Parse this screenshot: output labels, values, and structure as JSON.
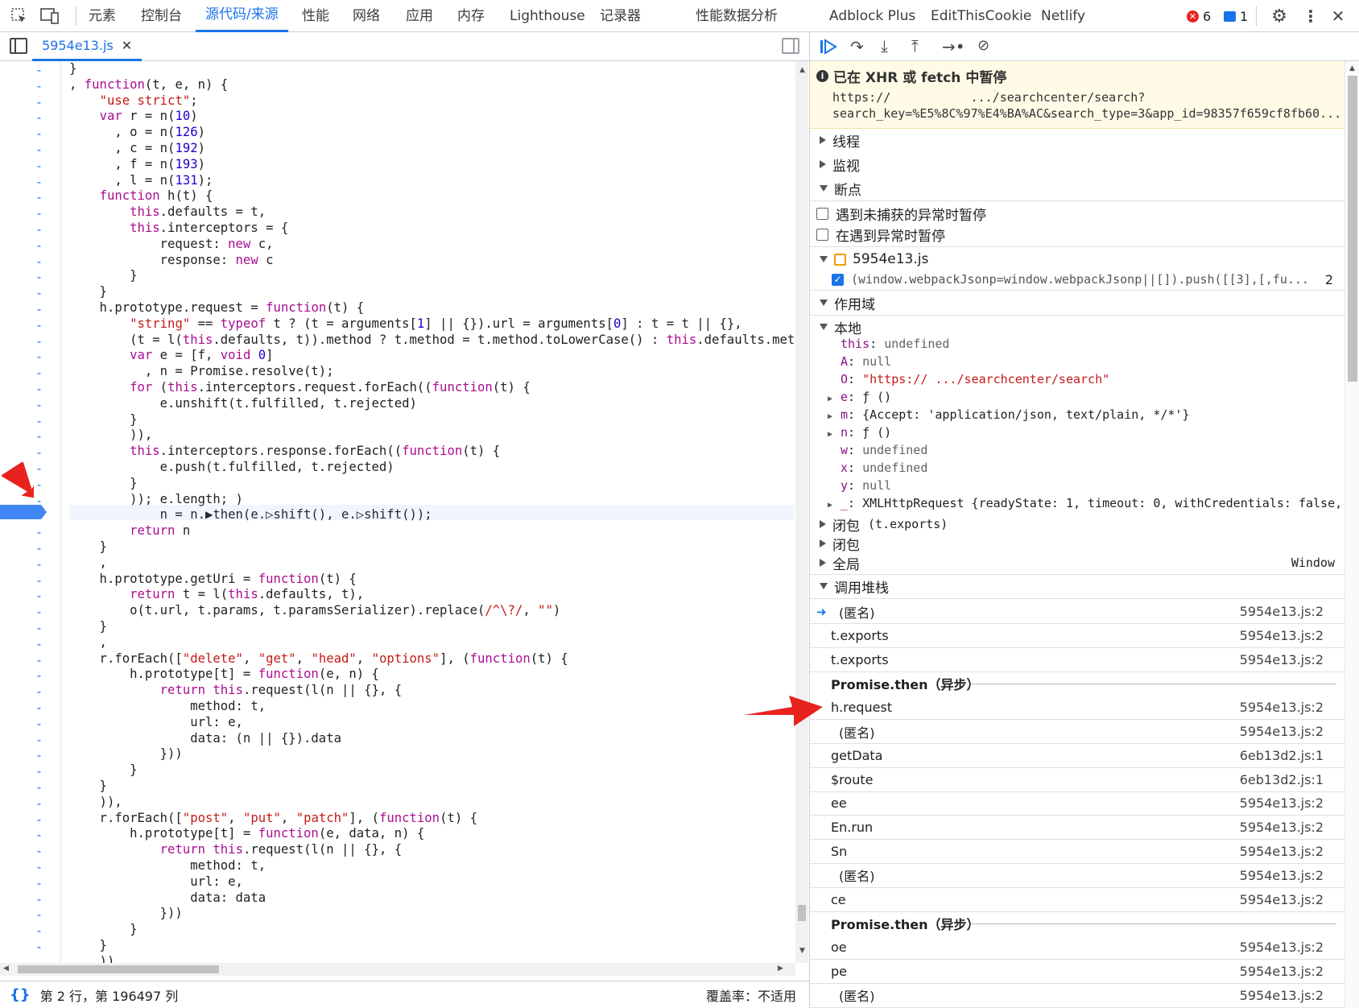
{
  "tabs": [
    "元素",
    "控制台",
    "源代码/来源",
    "性能",
    "网络",
    "应用",
    "内存",
    "Lighthouse",
    "记录器",
    "性能数据分析",
    "Adblock Plus",
    "EditThisCookie",
    "Netlify"
  ],
  "errors_count": "6",
  "messages_count": "1",
  "file_tab": "5954e13.js",
  "code_lines": [
    [
      {
        "t": "}"
      }
    ],
    [
      {
        "t": ", "
      },
      {
        "t": "function",
        "c": "kw"
      },
      {
        "t": "(t, e, n) {"
      }
    ],
    [
      {
        "t": "    "
      },
      {
        "t": "\"use strict\"",
        "c": "st"
      },
      {
        "t": ";"
      }
    ],
    [
      {
        "t": "    "
      },
      {
        "t": "var",
        "c": "kw"
      },
      {
        "t": " r = n("
      },
      {
        "t": "10",
        "c": "nm"
      },
      {
        "t": ")"
      }
    ],
    [
      {
        "t": "      , o = n("
      },
      {
        "t": "126",
        "c": "nm"
      },
      {
        "t": ")"
      }
    ],
    [
      {
        "t": "      , c = n("
      },
      {
        "t": "192",
        "c": "nm"
      },
      {
        "t": ")"
      }
    ],
    [
      {
        "t": "      , f = n("
      },
      {
        "t": "193",
        "c": "nm"
      },
      {
        "t": ")"
      }
    ],
    [
      {
        "t": "      , l = n("
      },
      {
        "t": "131",
        "c": "nm"
      },
      {
        "t": ");"
      }
    ],
    [
      {
        "t": "    "
      },
      {
        "t": "function",
        "c": "kw"
      },
      {
        "t": " h(t) {"
      }
    ],
    [
      {
        "t": "        "
      },
      {
        "t": "this",
        "c": "kw"
      },
      {
        "t": ".defaults = t,"
      }
    ],
    [
      {
        "t": "        "
      },
      {
        "t": "this",
        "c": "kw"
      },
      {
        "t": ".interceptors = {"
      }
    ],
    [
      {
        "t": "            request: "
      },
      {
        "t": "new",
        "c": "kw"
      },
      {
        "t": " c,"
      }
    ],
    [
      {
        "t": "            response: "
      },
      {
        "t": "new",
        "c": "kw"
      },
      {
        "t": " c"
      }
    ],
    [
      {
        "t": "        }"
      }
    ],
    [
      {
        "t": "    }"
      }
    ],
    [
      {
        "t": "    h.prototype.request = "
      },
      {
        "t": "function",
        "c": "kw"
      },
      {
        "t": "(t) {"
      }
    ],
    [
      {
        "t": "        "
      },
      {
        "t": "\"string\"",
        "c": "st"
      },
      {
        "t": " == "
      },
      {
        "t": "typeof",
        "c": "kw"
      },
      {
        "t": " t ? (t = arguments["
      },
      {
        "t": "1",
        "c": "nm"
      },
      {
        "t": "] || {}).url = arguments["
      },
      {
        "t": "0",
        "c": "nm"
      },
      {
        "t": "] : t = t || {},"
      }
    ],
    [
      {
        "t": "        (t = l("
      },
      {
        "t": "this",
        "c": "kw"
      },
      {
        "t": ".defaults, t)).method ? t.method = t.method.toLowerCase() : "
      },
      {
        "t": "this",
        "c": "kw"
      },
      {
        "t": ".defaults.method"
      }
    ],
    [
      {
        "t": "        "
      },
      {
        "t": "var",
        "c": "kw"
      },
      {
        "t": " e = [f, "
      },
      {
        "t": "void",
        "c": "kw"
      },
      {
        "t": " "
      },
      {
        "t": "0",
        "c": "nm"
      },
      {
        "t": "]"
      }
    ],
    [
      {
        "t": "          , n = Promise.resolve(t);"
      }
    ],
    [
      {
        "t": "        "
      },
      {
        "t": "for",
        "c": "kw"
      },
      {
        "t": " ("
      },
      {
        "t": "this",
        "c": "kw"
      },
      {
        "t": ".interceptors.request.forEach(("
      },
      {
        "t": "function",
        "c": "kw"
      },
      {
        "t": "(t) {"
      }
    ],
    [
      {
        "t": "            e.unshift(t.fulfilled, t.rejected)"
      }
    ],
    [
      {
        "t": "        }"
      }
    ],
    [
      {
        "t": "        )),"
      }
    ],
    [
      {
        "t": "        "
      },
      {
        "t": "this",
        "c": "kw"
      },
      {
        "t": ".interceptors.response.forEach(("
      },
      {
        "t": "function",
        "c": "kw"
      },
      {
        "t": "(t) {"
      }
    ],
    [
      {
        "t": "            e.push(t.fulfilled, t.rejected)"
      }
    ],
    [
      {
        "t": "        }"
      }
    ],
    [
      {
        "t": "        )); e.length; )"
      }
    ],
    [
      {
        "t": "            n = n.▶then(e.▷shift(), e.▷shift());"
      }
    ],
    [
      {
        "t": "        "
      },
      {
        "t": "return",
        "c": "kw"
      },
      {
        "t": " n"
      }
    ],
    [
      {
        "t": "    }"
      }
    ],
    [
      {
        "t": "    ,"
      }
    ],
    [
      {
        "t": "    h.prototype.getUri = "
      },
      {
        "t": "function",
        "c": "kw"
      },
      {
        "t": "(t) {"
      }
    ],
    [
      {
        "t": "        "
      },
      {
        "t": "return",
        "c": "kw"
      },
      {
        "t": " t = l("
      },
      {
        "t": "this",
        "c": "kw"
      },
      {
        "t": ".defaults, t),"
      }
    ],
    [
      {
        "t": "        o(t.url, t.params, t.paramsSerializer).replace("
      },
      {
        "t": "/^\\?/",
        "c": "st"
      },
      {
        "t": ", "
      },
      {
        "t": "\"\"",
        "c": "st"
      },
      {
        "t": ")"
      }
    ],
    [
      {
        "t": "    }"
      }
    ],
    [
      {
        "t": "    ,"
      }
    ],
    [
      {
        "t": "    r.forEach(["
      },
      {
        "t": "\"delete\"",
        "c": "st"
      },
      {
        "t": ", "
      },
      {
        "t": "\"get\"",
        "c": "st"
      },
      {
        "t": ", "
      },
      {
        "t": "\"head\"",
        "c": "st"
      },
      {
        "t": ", "
      },
      {
        "t": "\"options\"",
        "c": "st"
      },
      {
        "t": "], ("
      },
      {
        "t": "function",
        "c": "kw"
      },
      {
        "t": "(t) {"
      }
    ],
    [
      {
        "t": "        h.prototype[t] = "
      },
      {
        "t": "function",
        "c": "kw"
      },
      {
        "t": "(e, n) {"
      }
    ],
    [
      {
        "t": "            "
      },
      {
        "t": "return",
        "c": "kw"
      },
      {
        "t": " "
      },
      {
        "t": "this",
        "c": "kw"
      },
      {
        "t": ".request(l(n || {}, {"
      }
    ],
    [
      {
        "t": "                method: t,"
      }
    ],
    [
      {
        "t": "                url: e,"
      }
    ],
    [
      {
        "t": "                data: (n || {}).data"
      }
    ],
    [
      {
        "t": "            }))"
      }
    ],
    [
      {
        "t": "        }"
      }
    ],
    [
      {
        "t": "    }"
      }
    ],
    [
      {
        "t": "    )),"
      }
    ],
    [
      {
        "t": "    r.forEach(["
      },
      {
        "t": "\"post\"",
        "c": "st"
      },
      {
        "t": ", "
      },
      {
        "t": "\"put\"",
        "c": "st"
      },
      {
        "t": ", "
      },
      {
        "t": "\"patch\"",
        "c": "st"
      },
      {
        "t": "], ("
      },
      {
        "t": "function",
        "c": "kw"
      },
      {
        "t": "(t) {"
      }
    ],
    [
      {
        "t": "        h.prototype[t] = "
      },
      {
        "t": "function",
        "c": "kw"
      },
      {
        "t": "(e, data, n) {"
      }
    ],
    [
      {
        "t": "            "
      },
      {
        "t": "return",
        "c": "kw"
      },
      {
        "t": " "
      },
      {
        "t": "this",
        "c": "kw"
      },
      {
        "t": ".request(l(n || {}, {"
      }
    ],
    [
      {
        "t": "                method: t,"
      }
    ],
    [
      {
        "t": "                url: e,"
      }
    ],
    [
      {
        "t": "                data: data"
      }
    ],
    [
      {
        "t": "            }))"
      }
    ],
    [
      {
        "t": "        }"
      }
    ],
    [
      {
        "t": "    }"
      }
    ],
    [
      {
        "t": "    )),"
      }
    ]
  ],
  "paused": {
    "title": "已在 XHR 或 fetch 中暂停",
    "url1": "https://           .../searchcenter/search?",
    "url2": "search_key=%E5%8C%97%E4%BA%AC&search_type=3&app_id=98357f659cf8fb60..."
  },
  "sections": {
    "threads": "线程",
    "watch": "监视",
    "breakpoints": "断点",
    "pause_uncaught": "遇到未捕获的异常时暂停",
    "pause_caught": "在遇到异常时暂停",
    "bp_file": "5954e13.js",
    "bp_code": "(window.webpackJsonp=window.webpackJsonp||[]).push([[3],[,fu...",
    "bp_line": "2",
    "scope": "作用域",
    "local": "本地",
    "closure1": "闭包",
    "closure1_detail": "(t.exports)",
    "closure2": "闭包",
    "global": "全局",
    "global_value": "Window",
    "callstack": "调用堆栈"
  },
  "scope_vars": [
    {
      "k": "this",
      "v": "undefined",
      "t": "u",
      "exp": false
    },
    {
      "k": "A",
      "v": "null",
      "t": "u",
      "exp": false
    },
    {
      "k": "O",
      "v": "\"https://           .../searchcenter/search\"",
      "t": "s",
      "exp": false
    },
    {
      "k": "e",
      "v": "ƒ ()",
      "t": "n",
      "exp": true
    },
    {
      "k": "m",
      "v": "{Accept: 'application/json, text/plain, */*'}",
      "t": "n",
      "exp": true
    },
    {
      "k": "n",
      "v": "ƒ ()",
      "t": "n",
      "exp": true
    },
    {
      "k": "w",
      "v": "undefined",
      "t": "u",
      "exp": false
    },
    {
      "k": "x",
      "v": "undefined",
      "t": "u",
      "exp": false
    },
    {
      "k": "y",
      "v": "null",
      "t": "u",
      "exp": false
    },
    {
      "k": "_",
      "v": "XMLHttpRequest {readyState: 1, timeout: 0, withCredentials: false,",
      "t": "n",
      "exp": true
    }
  ],
  "call_stack": [
    {
      "fn": "(匿名)",
      "loc": "5954e13.js:2",
      "current": true
    },
    {
      "fn": "t.exports",
      "loc": "5954e13.js:2"
    },
    {
      "fn": "t.exports",
      "loc": "5954e13.js:2"
    },
    {
      "async": "Promise.then（异步）"
    },
    {
      "fn": "h.request",
      "loc": "5954e13.js:2"
    },
    {
      "fn": "(匿名)",
      "loc": "5954e13.js:2"
    },
    {
      "fn": "getData",
      "loc": "6eb13d2.js:1"
    },
    {
      "fn": "$route",
      "loc": "6eb13d2.js:1"
    },
    {
      "fn": "ee",
      "loc": "5954e13.js:2"
    },
    {
      "fn": "En.run",
      "loc": "5954e13.js:2"
    },
    {
      "fn": "Sn",
      "loc": "5954e13.js:2"
    },
    {
      "fn": "(匿名)",
      "loc": "5954e13.js:2"
    },
    {
      "fn": "ce",
      "loc": "5954e13.js:2"
    },
    {
      "async": "Promise.then（异步）"
    },
    {
      "fn": "oe",
      "loc": "5954e13.js:2"
    },
    {
      "fn": "pe",
      "loc": "5954e13.js:2"
    },
    {
      "fn": "(匿名)",
      "loc": "5954e13.js:2"
    }
  ],
  "status": {
    "position": "第 2 行，第 196497 列",
    "coverage": "覆盖率：不适用"
  },
  "colors": {
    "accent": "#1a73e8",
    "paused_bg": "#fffbe6",
    "arrow": "#e8231f",
    "keyword": "#aa0d91",
    "string": "#c41a16",
    "number": "#1c00cf"
  }
}
